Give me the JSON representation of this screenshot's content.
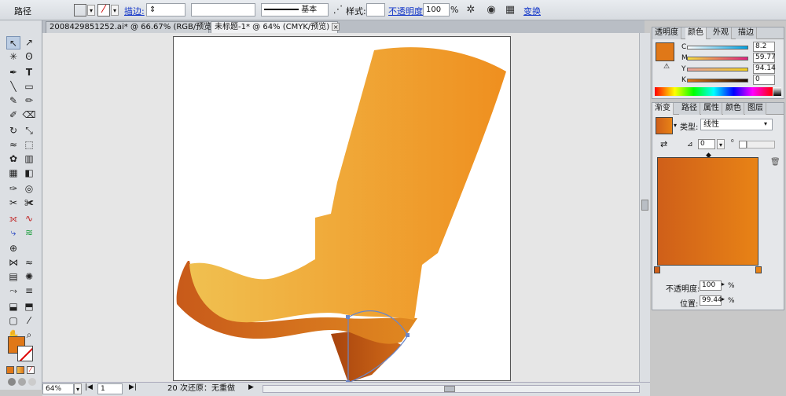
{
  "control_bar": {
    "object_type": "路径",
    "stroke_label": "描边:",
    "stroke_style": "基本",
    "style_label": "样式:",
    "opacity_label": "不透明度:",
    "opacity_value": "100",
    "percent": "%",
    "transform_label": "变换"
  },
  "tabs": [
    {
      "label": "2008429851252.ai* @ 66.67% (RGB/预览)",
      "close": "×"
    },
    {
      "label": "未标题-1* @ 64% (CMYK/预览)",
      "close": "×"
    }
  ],
  "tools": {
    "select": "↖",
    "direct_select": "↗",
    "magic_wand": "✳",
    "lasso": "ʘ",
    "pen": "✒",
    "type": "T",
    "line": "╲",
    "rect": "▭",
    "brush": "✎",
    "pencil": "✏",
    "blob": "✐",
    "eraser": "⌫",
    "rotate": "↻",
    "scale": "⤡",
    "warp": "≈",
    "free_transform": "⬚",
    "symbol": "✿",
    "graph": "▥",
    "mesh": "▦",
    "gradient": "◧",
    "eyedropper": "✑",
    "blend": "◎",
    "slice": "✂",
    "scissors": "✀",
    "width": "⟗",
    "perspective": "▤",
    "hand": "✋",
    "zoom": "🔍"
  },
  "colors": {
    "fill": "#e07818",
    "boot_light": "#f0c050",
    "boot_dark": "#e08820",
    "sole_dark": "#c85a1a",
    "heel_dark": "#a8440e",
    "grad_start": "#cf5f19",
    "grad_end": "#e88316"
  },
  "color_panel": {
    "tabs": [
      "透明度",
      "颜色",
      "外观",
      "描边"
    ],
    "channels": [
      {
        "name": "C",
        "value": "8.2"
      },
      {
        "name": "M",
        "value": "59.77"
      },
      {
        "name": "Y",
        "value": "94.14"
      },
      {
        "name": "K",
        "value": "0"
      }
    ]
  },
  "gradient_panel": {
    "tabs": [
      "渐变",
      "路径",
      "属性",
      "颜色",
      "图层"
    ],
    "type_label": "类型:",
    "type_value": "线性",
    "angle_value": "0",
    "opacity_label": "不透明度:",
    "opacity_value": "100",
    "location_label": "位置:",
    "location_value": "99.44",
    "percent": "%"
  },
  "status_bar": {
    "zoom": "64%",
    "page": "1",
    "undo_text": "20 次还原：无重做"
  }
}
